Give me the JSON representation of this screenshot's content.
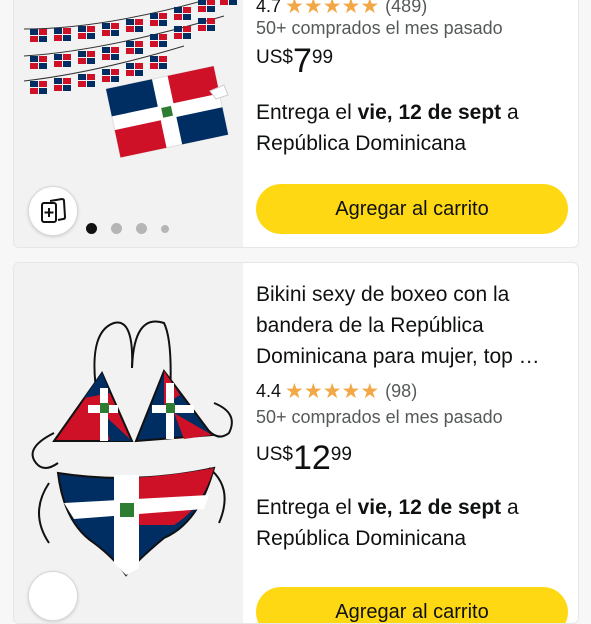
{
  "products": [
    {
      "title": "",
      "rating": "4.7",
      "rating_count": "(489)",
      "bought": "50+ comprados el mes pasado",
      "price": {
        "currency": "US$",
        "whole": "7",
        "fraction": "99"
      },
      "delivery": {
        "prefix": "Entrega el ",
        "date": "vie, 12 de sept",
        "suffix": " a",
        "destination": "República Dominicana"
      },
      "cart_label": "Agregar al carrito",
      "image_icon": "dominican-flag-bunting-image",
      "compare_icon": "compare-cards-icon",
      "image_dots": 4
    },
    {
      "title": "Bikini sexy de boxeo con la bandera de la República Dominicana para mujer, top …",
      "rating": "4.4",
      "rating_count": "(98)",
      "bought": "50+ comprados el mes pasado",
      "price": {
        "currency": "US$",
        "whole": "12",
        "fraction": "99"
      },
      "delivery": {
        "prefix": "Entrega el ",
        "date": "vie, 12 de sept",
        "suffix": " a",
        "destination": "República Dominicana"
      },
      "cart_label": "Agregar al carrito",
      "image_icon": "dominican-flag-bikini-image"
    }
  ],
  "colors": {
    "star": "#f3a847",
    "button": "#ffd814",
    "flag_blue": "#002d62",
    "flag_red": "#ce1126"
  }
}
